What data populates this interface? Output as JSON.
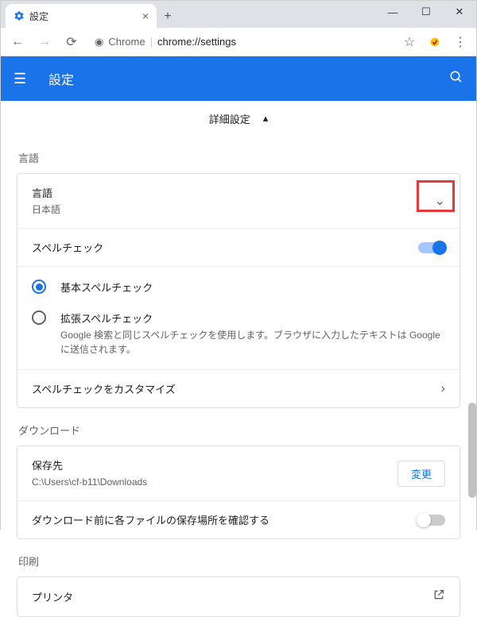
{
  "window": {
    "title": "設定"
  },
  "addressBar": {
    "siteLabel": "Chrome",
    "url": "chrome://settings"
  },
  "header": {
    "title": "設定"
  },
  "advanced": {
    "label": "詳細設定"
  },
  "language": {
    "sectionTitle": "言語",
    "langLabel": "言語",
    "langValue": "日本語",
    "spellCheck": "スペルチェック",
    "basicSpell": "基本スペルチェック",
    "extSpell": "拡張スペルチェック",
    "extSpellDesc": "Google 検索と同じスペルチェックを使用します。ブラウザに入力したテキストは Google に送信されます。",
    "customize": "スペルチェックをカスタマイズ"
  },
  "download": {
    "sectionTitle": "ダウンロード",
    "savePathLabel": "保存先",
    "savePathValue": "C:\\Users\\cf-b11\\Downloads",
    "changeBtn": "変更",
    "confirmLocation": "ダウンロード前に各ファイルの保存場所を確認する"
  },
  "print": {
    "sectionTitle": "印刷",
    "printer": "プリンタ"
  }
}
